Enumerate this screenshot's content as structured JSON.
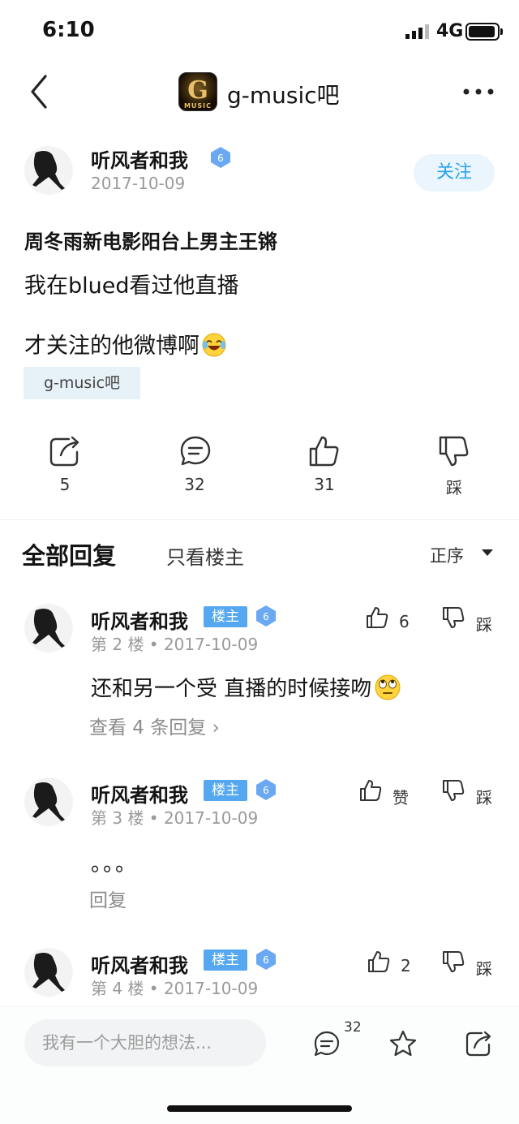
{
  "status": {
    "time": "6:10",
    "network": "4G"
  },
  "nav": {
    "forum_title": "g-music吧",
    "logo_letter": "G",
    "logo_text": "MUSIC"
  },
  "post": {
    "author": "听风者和我",
    "level": "6",
    "date": "2017-10-09",
    "follow_label": "关注",
    "title": "周冬雨新电影阳台上男主王锵",
    "lines": [
      "我在blued看过他直播",
      "才关注的他微博啊"
    ],
    "tag": "g-music吧",
    "stats": {
      "share": "5",
      "comments": "32",
      "likes": "31",
      "dislike_label": "踩"
    }
  },
  "replies_header": {
    "all": "全部回复",
    "only_op": "只看楼主",
    "sort": "正序"
  },
  "replies": [
    {
      "author": "听风者和我",
      "op_badge": "楼主",
      "level": "6",
      "meta": "第 2 楼 • 2017-10-09",
      "like_label": "6",
      "dislike_label": "踩",
      "text": "还和另一个受 直播的时候接吻",
      "link": "查看 4 条回复 ›"
    },
    {
      "author": "听风者和我",
      "op_badge": "楼主",
      "level": "6",
      "meta": "第 3 楼 • 2017-10-09",
      "like_label": "赞",
      "dislike_label": "踩",
      "text": "。。。",
      "link": "回复"
    },
    {
      "author": "听风者和我",
      "op_badge": "楼主",
      "level": "6",
      "meta": "第 4 楼 • 2017-10-09",
      "like_label": "2",
      "dislike_label": "踩"
    }
  ],
  "bottom": {
    "placeholder": "我有一个大胆的想法...",
    "comment_count": "32"
  },
  "colors": {
    "accent": "#2aa3ef",
    "op_badge": "#55a8f0",
    "level_badge": "#6aa9f2"
  }
}
